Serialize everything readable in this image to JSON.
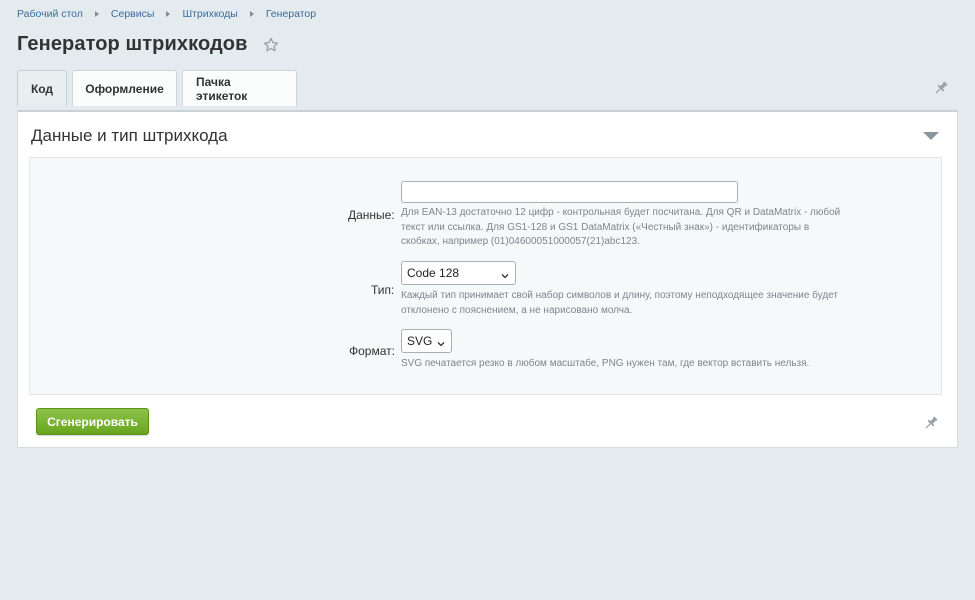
{
  "breadcrumbs": [
    "Рабочий стол",
    "Сервисы",
    "Штрихкоды",
    "Генератор"
  ],
  "page_title": "Генератор штрихкодов",
  "tabs": [
    {
      "label": "Код",
      "active": true
    },
    {
      "label": "Оформление",
      "active": false
    },
    {
      "label": "Пачка этикеток",
      "active": false
    }
  ],
  "section": {
    "title": "Данные и тип штрихкода"
  },
  "form": {
    "data": {
      "label": "Данные:",
      "value": "",
      "hint_lines": [
        "Для EAN-13 достаточно 12 цифр - контрольная будет посчитана. Для QR и DataMatrix - любой",
        "текст или ссылка. Для GS1-128 и GS1 DataMatrix («Честный знак») - идентификаторы в",
        "скобках, например (01)04600051000057(21)abc123."
      ]
    },
    "type": {
      "label": "Тип:",
      "selected": "Code 128",
      "hint_lines": [
        "Каждый тип принимает свой набор символов и длину, поэтому неподходящее значение будет",
        "отклонено с пояснением, а не нарисовано молча."
      ]
    },
    "format": {
      "label": "Формат:",
      "selected": "SVG",
      "hint_lines": [
        "SVG печатается резко в любом масштабе, PNG нужен там, где вектор вставить нельзя."
      ]
    }
  },
  "buttons": {
    "generate_label": "Сгенерировать"
  },
  "icons": {
    "favorite": "star-icon",
    "pin": "pin-icon",
    "collapse": "triangle-down-icon",
    "select_arrow": "chevron-down-icon"
  },
  "colors": {
    "background": "#e4ebef",
    "link": "#3d6b96",
    "primary_button": "#78b32f"
  }
}
